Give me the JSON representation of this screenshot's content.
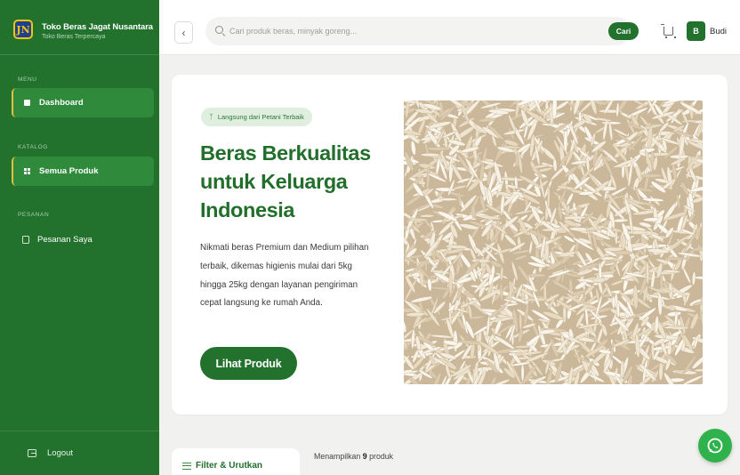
{
  "brand": {
    "logo_text": "JN",
    "name": "Toko Beras Jagat Nusantara",
    "tagline": "Toko Beras Terpercaya"
  },
  "sidebar": {
    "sections": [
      {
        "label": "MENU",
        "items": [
          {
            "label": "Dashboard",
            "icon": "home-icon",
            "active": false
          }
        ]
      },
      {
        "label": "KATALOG",
        "items": [
          {
            "label": "Semua Produk",
            "icon": "grid-icon",
            "active": true
          }
        ]
      },
      {
        "label": "PESANAN",
        "items": [
          {
            "label": "Pesanan Saya",
            "icon": "bag-icon",
            "active": false
          }
        ]
      }
    ],
    "logout_label": "Logout"
  },
  "topbar": {
    "search_placeholder": "Cari produk beras, minyak goreng...",
    "search_button": "Cari",
    "avatar_initial": "B",
    "username": "Budi"
  },
  "hero": {
    "badge": "Langsung dari Petani Terbaik",
    "title": "Beras Berkualitas untuk Keluarga Indonesia",
    "description": "Nikmati beras Premium dan Medium pilihan terbaik, dikemas higienis mulai dari 5kg hingga 25kg dengan layanan pengiriman cepat langsung ke rumah Anda.",
    "cta_label": "Lihat Produk"
  },
  "catalog": {
    "filter_label": "Filter & Urutkan",
    "count_prefix": "Menampilkan ",
    "count_value": "9",
    "count_suffix": " produk"
  },
  "colors": {
    "primary": "#22722e",
    "accent": "#e3c23b",
    "whatsapp": "#2fb24c",
    "background": "#f1f2ef"
  }
}
